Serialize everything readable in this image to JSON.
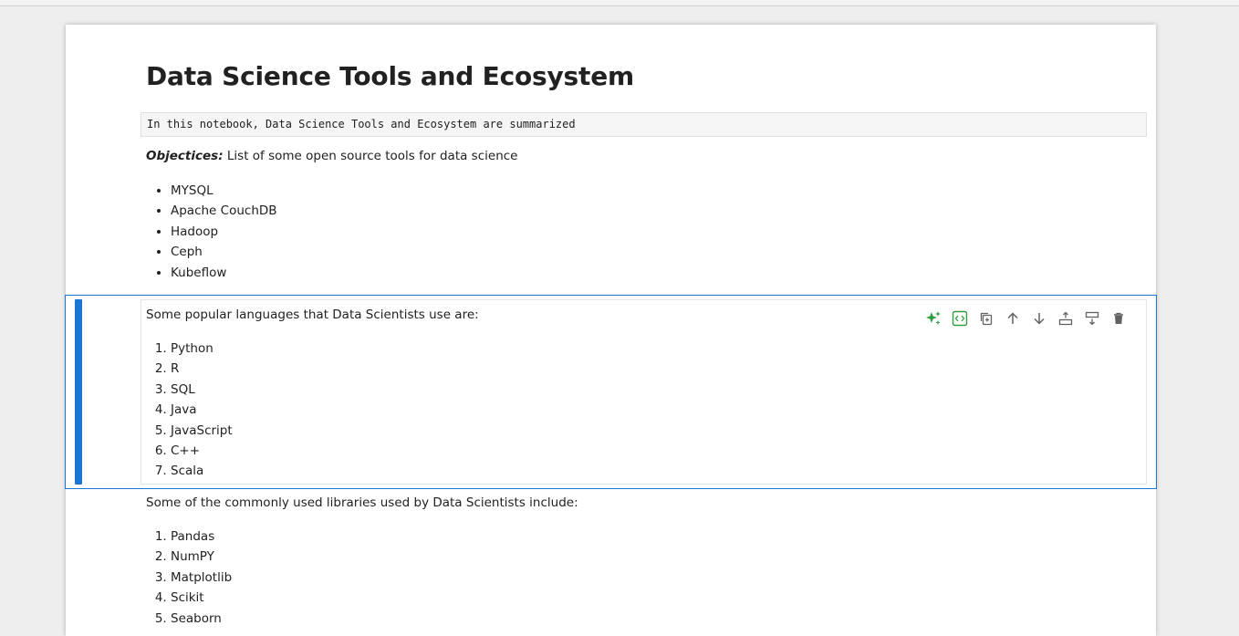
{
  "notebook": {
    "title": "Data Science Tools and Ecosystem",
    "code_cell": "In this notebook, Data Science Tools and Ecosystem are summarized",
    "objectives": {
      "label": "Objectices:",
      "text": " List of some open source tools for data science"
    },
    "tools": [
      "MYSQL",
      "Apache CouchDB",
      "Hadoop",
      "Ceph",
      "Kubeflow"
    ],
    "languages_intro": "Some popular languages that Data Scientists use are:",
    "languages": [
      "Python",
      "R",
      "SQL",
      "Java",
      "JavaScript",
      "C++",
      "Scala"
    ],
    "libraries_intro": "Some of the commonly used libraries used by Data Scientists include:",
    "libraries": [
      "Pandas",
      "NumPY",
      "Matplotlib",
      "Scikit",
      "Seaborn"
    ]
  },
  "toolbar": {
    "icons": [
      "sparkle-icon",
      "code-toggle-icon",
      "duplicate-icon",
      "arrow-up-icon",
      "arrow-down-icon",
      "insert-above-icon",
      "insert-below-icon",
      "trash-icon"
    ]
  },
  "colors": {
    "active_cell": "#1976d2",
    "ai_green": "#2e9e3e",
    "toolbar_icon": "#616161"
  }
}
